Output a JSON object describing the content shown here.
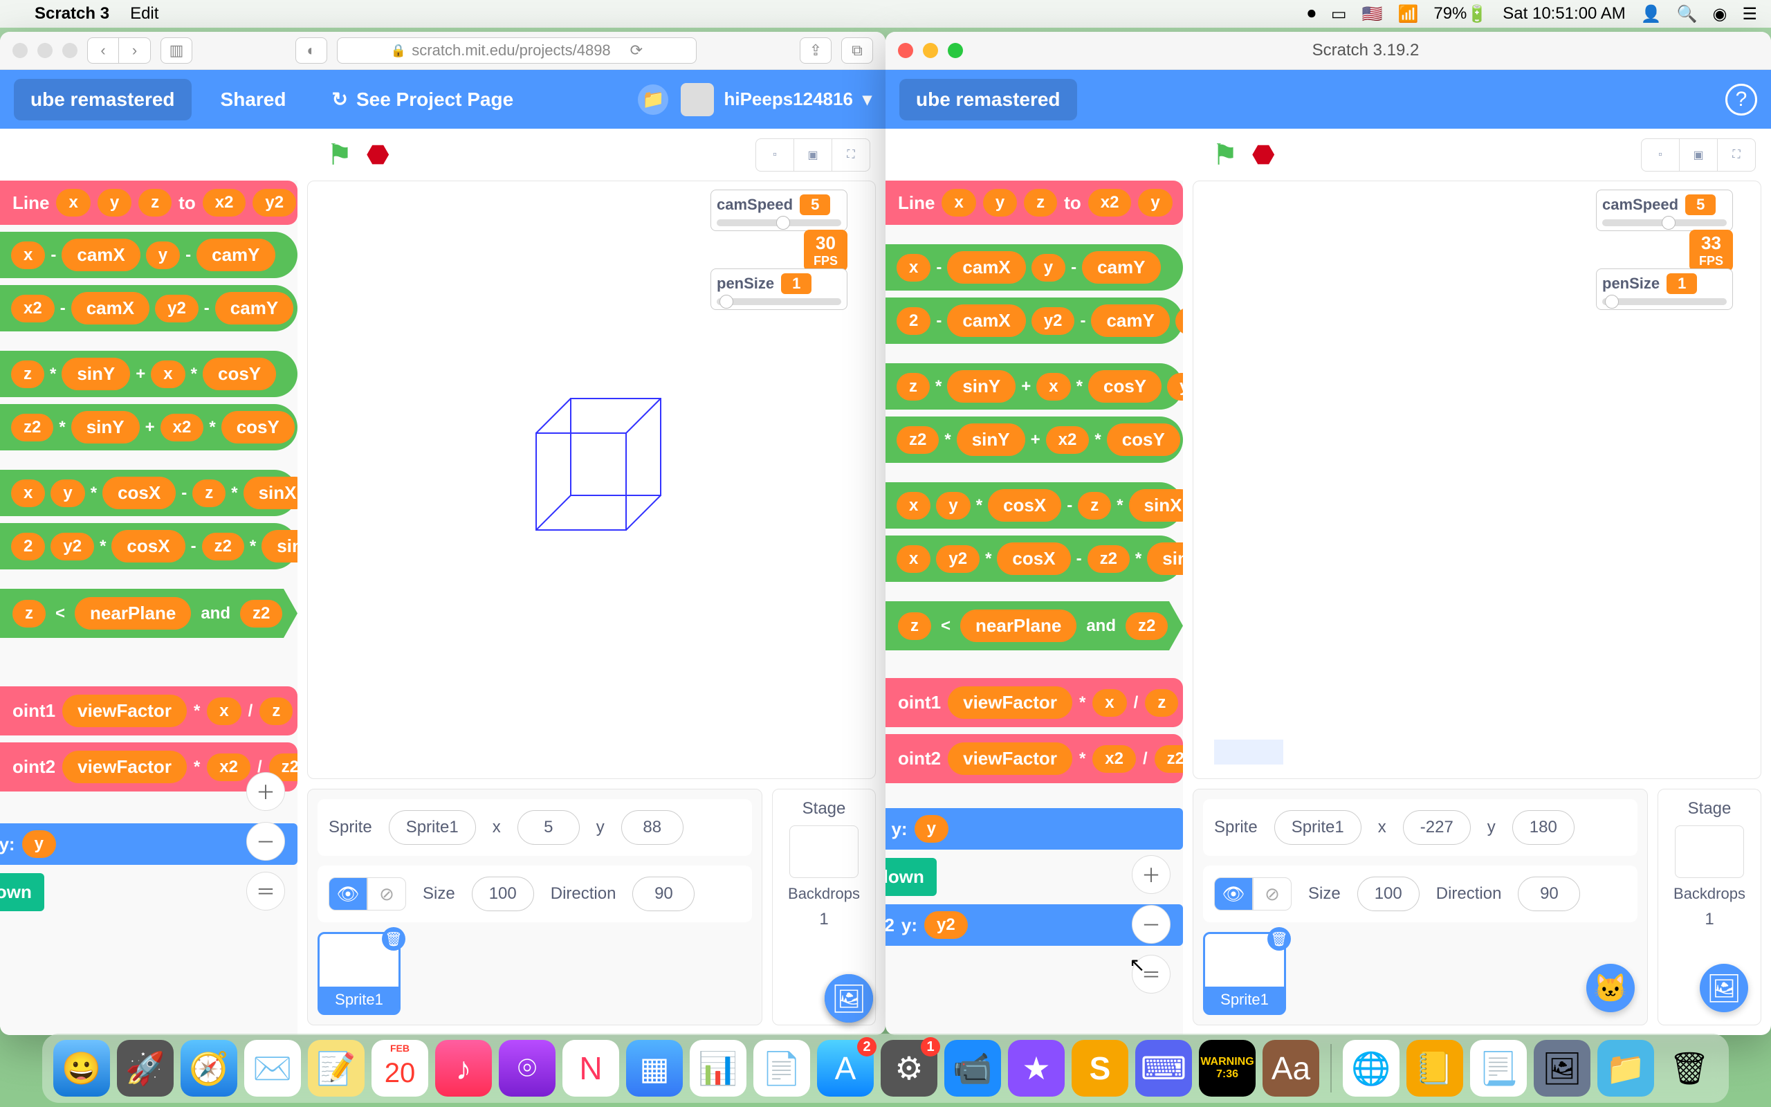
{
  "menubar": {
    "app": "Scratch 3",
    "menu_edit": "Edit",
    "battery": "79%",
    "clock": "Sat 10:51:00 AM"
  },
  "safari": {
    "url_host": "scratch.mit.edu/projects/4898",
    "header_project": "ube remastered",
    "header_shared": "Shared",
    "header_see": "See Project Page",
    "header_user": "hiPeeps124816",
    "camSpeed_label": "camSpeed",
    "camSpeed_val": "5",
    "penSize_label": "penSize",
    "penSize_val": "1",
    "fps": "30",
    "fps_lbl": "FPS",
    "sprite_label": "Sprite",
    "sprite_name": "Sprite1",
    "x_label": "x",
    "x_val": "5",
    "y_label": "y",
    "y_val": "88",
    "size_label": "Size",
    "size_val": "100",
    "dir_label": "Direction",
    "dir_val": "90",
    "stage_label": "Stage",
    "backdrops_label": "Backdrops",
    "backdrops_count": "1",
    "spritecard": "Sprite1",
    "blocks": {
      "line": "Line",
      "x": "x",
      "y": "y",
      "z": "z",
      "to": "to",
      "x2": "x2",
      "y2": "y2",
      "camX": "camX",
      "camY": "camY",
      "sinY": "sinY",
      "cosY": "cosY",
      "cosX": "cosX",
      "sinX": "sinX",
      "nearPlane": "nearPlane",
      "and": "and",
      "z2": "z2",
      "oint1": "oint1",
      "oint2": "oint2",
      "viewFactor": "viewFactor",
      "goto_xy": "x    y:",
      "pen_down": "down",
      "minus": "-",
      "plus": "+",
      "star": "*",
      "lt": "<",
      "slash": "/"
    }
  },
  "desktop": {
    "title": "Scratch 3.19.2",
    "header_project": "ube remastered",
    "camSpeed_label": "camSpeed",
    "camSpeed_val": "5",
    "penSize_label": "penSize",
    "penSize_val": "1",
    "fps": "33",
    "fps_lbl": "FPS",
    "sprite_label": "Sprite",
    "sprite_name": "Sprite1",
    "x_label": "x",
    "x_val": "-227",
    "y_label": "y",
    "y_val": "180",
    "size_label": "Size",
    "size_val": "100",
    "dir_label": "Direction",
    "dir_val": "90",
    "stage_label": "Stage",
    "backdrops_label": "Backdrops",
    "backdrops_count": "1",
    "spritecard": "Sprite1",
    "blocks": {
      "line": "Line",
      "x": "x",
      "y": "y",
      "z": "z",
      "to": "to",
      "x2": "x2",
      "y2": "y2",
      "camX": "camX",
      "camY": "camY",
      "sinY": "sinY",
      "cosY": "cosY",
      "cosX": "cosX",
      "sinX": "sinX",
      "nearPlane": "nearPlane",
      "and": "and",
      "z2": "z2",
      "oint1": "oint1",
      "oint2": "oint2",
      "viewFactor": "viewFactor",
      "goto_y": "y:",
      "pen_down": "down",
      "y2v": "y2"
    }
  }
}
